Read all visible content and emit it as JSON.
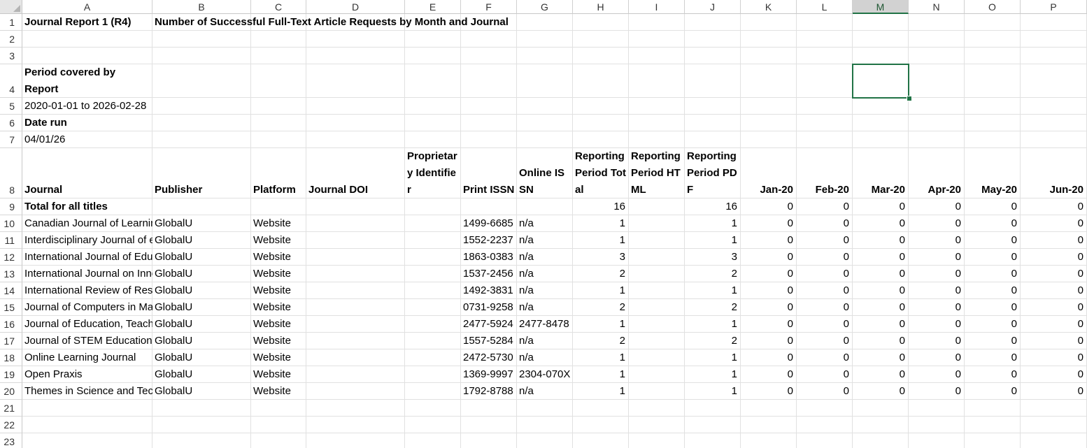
{
  "sheet": {
    "columns": [
      "A",
      "B",
      "C",
      "D",
      "E",
      "F",
      "G",
      "H",
      "I",
      "J",
      "K",
      "L",
      "M",
      "N",
      "O",
      "P"
    ],
    "selected_column": "M",
    "selected_cell": "M4",
    "rows": [
      "1",
      "2",
      "3",
      "4",
      "5",
      "6",
      "7",
      "8",
      "9",
      "10",
      "11",
      "12",
      "13",
      "14",
      "15",
      "16",
      "17",
      "18",
      "19",
      "20",
      "21",
      "22",
      "23"
    ],
    "report_title": "Journal Report 1 (R4)",
    "report_subtitle": "Number of Successful Full-Text Article Requests by Month and Journal",
    "period_label": "Period covered by Report",
    "period_value": "2020-01-01 to 2026-02-28",
    "date_run_label": "Date run",
    "date_run_value": "04/01/26",
    "headers": {
      "journal": "Journal",
      "publisher": "Publisher",
      "platform": "Platform",
      "doi": "Journal DOI",
      "prop_id": "Proprietary Identifier",
      "print_issn": "Print ISSN",
      "online_issn": "Online ISSN",
      "rp_total": "Reporting Period Total",
      "rp_html": "Reporting Period HTML",
      "rp_pdf": "Reporting Period PDF",
      "months": [
        "Jan-20",
        "Feb-20",
        "Mar-20",
        "Apr-20",
        "May-20",
        "Jun-20"
      ]
    },
    "total_row": {
      "label": "Total for all titles",
      "rp_total": "16",
      "rp_pdf": "16",
      "months": [
        "0",
        "0",
        "0",
        "0",
        "0",
        "0"
      ]
    },
    "journals": [
      {
        "journal": "Canadian Journal of Learning and Technology",
        "publisher": "GlobalU",
        "platform": "Website",
        "print_issn": "1499-6685",
        "online_issn": "n/a",
        "rp_total": "1",
        "rp_pdf": "1",
        "months": [
          "0",
          "0",
          "0",
          "0",
          "0",
          "0"
        ]
      },
      {
        "journal": "Interdisciplinary Journal of e-Skills",
        "publisher": "GlobalU",
        "platform": "Website",
        "print_issn": "1552-2237",
        "online_issn": "n/a",
        "rp_total": "1",
        "rp_pdf": "1",
        "months": [
          "0",
          "0",
          "0",
          "0",
          "0",
          "0"
        ]
      },
      {
        "journal": "International Journal of Educational Technology",
        "publisher": "GlobalU",
        "platform": "Website",
        "print_issn": "1863-0383",
        "online_issn": "n/a",
        "rp_total": "3",
        "rp_pdf": "3",
        "months": [
          "0",
          "0",
          "0",
          "0",
          "0",
          "0"
        ]
      },
      {
        "journal": "International Journal on Innovations",
        "publisher": "GlobalU",
        "platform": "Website",
        "print_issn": "1537-2456",
        "online_issn": "n/a",
        "rp_total": "2",
        "rp_pdf": "2",
        "months": [
          "0",
          "0",
          "0",
          "0",
          "0",
          "0"
        ]
      },
      {
        "journal": "International Review of Research",
        "publisher": "GlobalU",
        "platform": "Website",
        "print_issn": "1492-3831",
        "online_issn": "n/a",
        "rp_total": "1",
        "rp_pdf": "1",
        "months": [
          "0",
          "0",
          "0",
          "0",
          "0",
          "0"
        ]
      },
      {
        "journal": "Journal of Computers in Mathematics",
        "publisher": "GlobalU",
        "platform": "Website",
        "print_issn": "0731-9258",
        "online_issn": "n/a",
        "rp_total": "2",
        "rp_pdf": "2",
        "months": [
          "0",
          "0",
          "0",
          "0",
          "0",
          "0"
        ]
      },
      {
        "journal": "Journal of Education, Teaching",
        "publisher": "GlobalU",
        "platform": "Website",
        "print_issn": "2477-5924",
        "online_issn": "2477-8478",
        "rp_total": "1",
        "rp_pdf": "1",
        "months": [
          "0",
          "0",
          "0",
          "0",
          "0",
          "0"
        ]
      },
      {
        "journal": "Journal of STEM Education",
        "publisher": "GlobalU",
        "platform": "Website",
        "print_issn": "1557-5284",
        "online_issn": "n/a",
        "rp_total": "2",
        "rp_pdf": "2",
        "months": [
          "0",
          "0",
          "0",
          "0",
          "0",
          "0"
        ]
      },
      {
        "journal": "Online Learning Journal",
        "publisher": "GlobalU",
        "platform": "Website",
        "print_issn": "2472-5730",
        "online_issn": "n/a",
        "rp_total": "1",
        "rp_pdf": "1",
        "months": [
          "0",
          "0",
          "0",
          "0",
          "0",
          "0"
        ]
      },
      {
        "journal": "Open Praxis",
        "publisher": "GlobalU",
        "platform": "Website",
        "print_issn": "1369-9997",
        "online_issn": "2304-070X",
        "rp_total": "1",
        "rp_pdf": "1",
        "months": [
          "0",
          "0",
          "0",
          "0",
          "0",
          "0"
        ]
      },
      {
        "journal": "Themes in Science and Technology",
        "publisher": "GlobalU",
        "platform": "Website",
        "print_issn": "1792-8788",
        "online_issn": "n/a",
        "rp_total": "1",
        "rp_pdf": "1",
        "months": [
          "0",
          "0",
          "0",
          "0",
          "0",
          "0"
        ]
      }
    ]
  }
}
